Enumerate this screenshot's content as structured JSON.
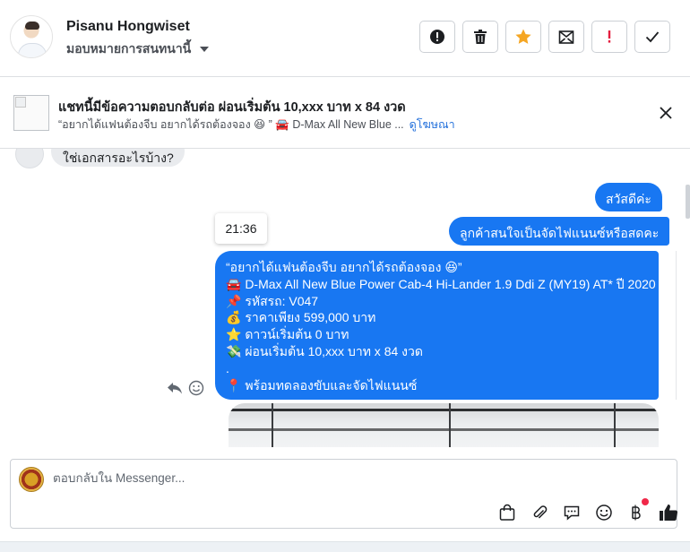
{
  "header": {
    "name": "Pisanu Hongwiset",
    "assign_label": "มอบหมายการสนทนานี้",
    "actions": [
      {
        "name": "alert-button",
        "icon": "exclamation-circle-icon"
      },
      {
        "name": "delete-button",
        "icon": "trash-icon"
      },
      {
        "name": "star-button",
        "icon": "star-icon",
        "color": "#f5a623"
      },
      {
        "name": "mark-unread-button",
        "icon": "envelope-open-icon"
      },
      {
        "name": "spam-button",
        "icon": "exclamation-icon",
        "color": "#e41e3f"
      },
      {
        "name": "done-button",
        "icon": "check-icon"
      }
    ]
  },
  "ad_banner": {
    "title": "แชทนี้มีข้อความตอบกลับต่อ ผ่อนเริ่มต้น 10,xxx บาท x 84 งวด",
    "snippet": "“อยากได้แฟนต้องจีบ อยากได้รถต้องจอง 😆 ”  🚘 D-Max All New Blue ...",
    "link": "ดูโฆษณา"
  },
  "chat": {
    "incoming_partial": "ใช่เอกสารอะไรบ้าง?",
    "time_chip": "21:36",
    "outgoing": [
      "สวัสดีค่ะ",
      "ลูกค้าสนใจเป็นจัดไฟแนนซ์หรือสดคะ"
    ],
    "ad_message_lines": [
      "“อยากได้แฟนต้องจีบ อยากได้รถต้องจอง 😆”",
      "🚘 D-Max All New Blue Power Cab-4 Hi-Lander 1.9 Ddi Z (MY19) AT* ปี 2020",
      "📌 รหัสรถ: V047",
      "💰 ราคาเพียง 599,000 บาท",
      "⭐ ดาวน์เริ่มต้น 0 บาท",
      "💸 ผ่อนเริ่มต้น 10,xxx บาท x 84 งวด",
      ".",
      "📍 พร้อมทดลองขับและจัดไฟแนนซ์"
    ]
  },
  "composer": {
    "placeholder": "ตอบกลับใน Messenger...",
    "tools": [
      "shopping-bag-icon",
      "paperclip-icon",
      "saved-reply-icon",
      "emoji-icon",
      "baht-icon",
      "thumbs-up-icon"
    ],
    "accent": "#1877f2"
  }
}
